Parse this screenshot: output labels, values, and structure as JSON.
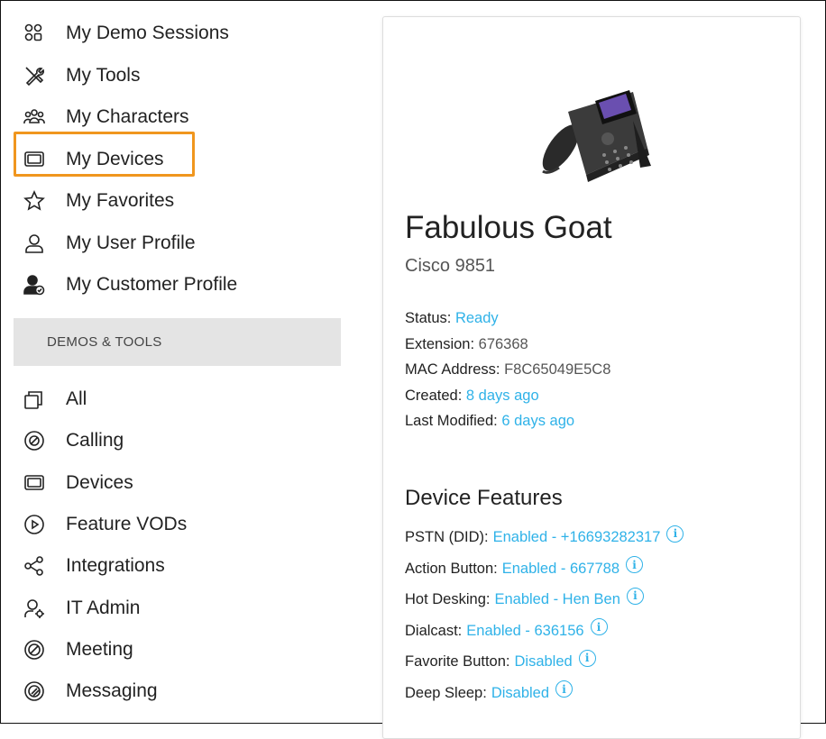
{
  "sidebar": {
    "items": [
      {
        "label": "My Demo Sessions",
        "icon": "grid-icon"
      },
      {
        "label": "My Tools",
        "icon": "tools-icon"
      },
      {
        "label": "My Characters",
        "icon": "characters-icon"
      },
      {
        "label": "My Devices",
        "icon": "device-icon"
      },
      {
        "label": "My Favorites",
        "icon": "star-icon"
      },
      {
        "label": "My User Profile",
        "icon": "user-icon"
      },
      {
        "label": "My Customer Profile",
        "icon": "customer-icon"
      }
    ],
    "section_header": "DEMOS & TOOLS",
    "categories": [
      {
        "label": "All",
        "icon": "copy-icon"
      },
      {
        "label": "Calling",
        "icon": "calling-icon"
      },
      {
        "label": "Devices",
        "icon": "device-icon"
      },
      {
        "label": "Feature VODs",
        "icon": "play-icon"
      },
      {
        "label": "Integrations",
        "icon": "share-icon"
      },
      {
        "label": "IT Admin",
        "icon": "admin-icon"
      },
      {
        "label": "Meeting",
        "icon": "meeting-icon"
      },
      {
        "label": "Messaging",
        "icon": "messaging-icon"
      }
    ],
    "highlight_color": "#f0961e"
  },
  "device": {
    "name": "Fabulous Goat",
    "model": "Cisco 9851",
    "status_label": "Status:",
    "status_value": "Ready",
    "extension_label": "Extension:",
    "extension_value": "676368",
    "mac_label": "MAC Address:",
    "mac_value": "F8C65049E5C8",
    "created_label": "Created:",
    "created_value": "8 days ago",
    "modified_label": "Last Modified:",
    "modified_value": "6 days ago"
  },
  "features": {
    "title": "Device Features",
    "items": [
      {
        "label": "PSTN (DID):",
        "value": "Enabled - +16693282317"
      },
      {
        "label": "Action Button:",
        "value": "Enabled - 667788"
      },
      {
        "label": "Hot Desking:",
        "value": "Enabled - Hen Ben"
      },
      {
        "label": "Dialcast:",
        "value": "Enabled - 636156"
      },
      {
        "label": "Favorite Button:",
        "value": "Disabled"
      },
      {
        "label": "Deep Sleep:",
        "value": "Disabled"
      }
    ]
  },
  "colors": {
    "link": "#2fb2e8",
    "section_bg": "#e4e4e4"
  }
}
